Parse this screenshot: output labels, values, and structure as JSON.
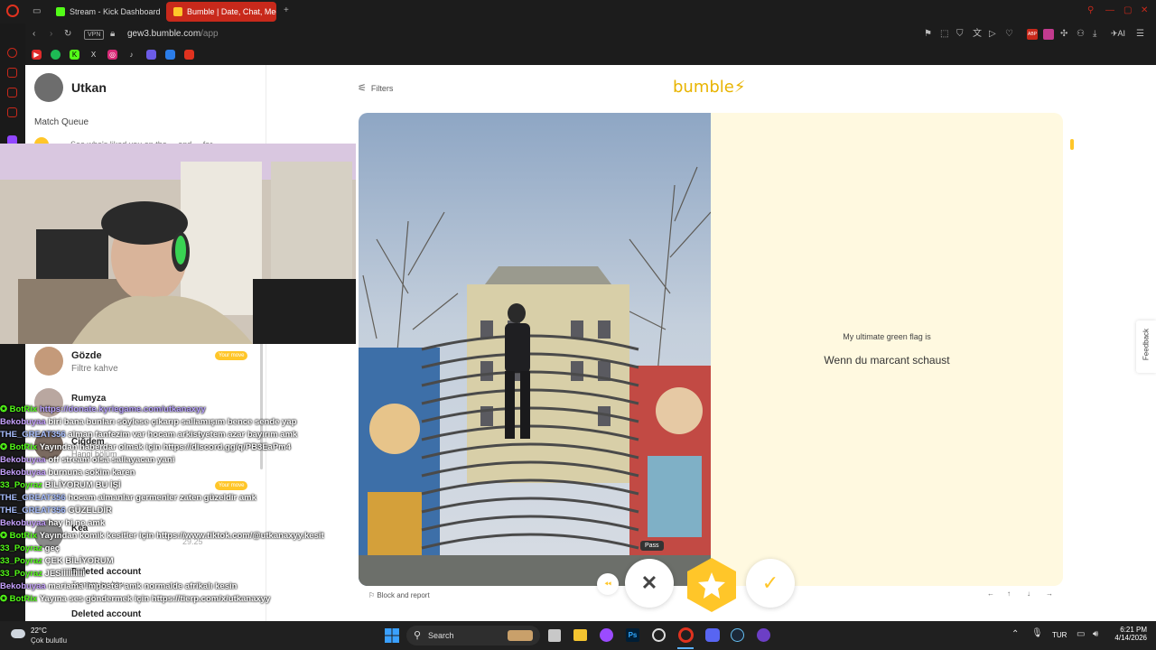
{
  "browser": {
    "tabs": [
      {
        "title": "Stream - Kick Dashboard",
        "color": "#53fc18"
      },
      {
        "title": "Bumble | Date, Chat, Meet",
        "color": "#ffc629"
      }
    ],
    "vpn_label": "VPN",
    "url_host": "gew3.bumble.com",
    "url_path": "/app",
    "ai_label": "AI",
    "abp_label": "ABP"
  },
  "sidebar": {
    "username": "Utkan",
    "match_queue_label": "Match Queue",
    "peek_text": "See who's liked you on the ... and ... for ...",
    "conversations": [
      {
        "name": "Gözde",
        "preview": "Filtre kahve",
        "badge": "Your move"
      },
      {
        "name": "Rumyza",
        "preview": ""
      },
      {
        "name": "Çiğdem",
        "preview": "Hangi bölüm"
      },
      {
        "name": "",
        "preview": "",
        "badge": "Your move"
      },
      {
        "name": "Kea",
        "preview": "",
        "meta": "29.25"
      },
      {
        "name": "Deleted account",
        "preview": "Tamam bu btw"
      },
      {
        "name": "Deleted account",
        "preview": ""
      }
    ]
  },
  "main": {
    "filters_label": "Filters",
    "logo_text": "bumble",
    "prompt_question": "My ultimate green flag is",
    "prompt_answer": "Wenn du marcant schaust",
    "feedback_label": "Feedback",
    "block_report_label": "Block and report",
    "pass_tooltip": "Pass",
    "action_colors": {
      "superswipe": "#ffc629",
      "like": "#ffc629",
      "backtrack": "#ffc629"
    }
  },
  "chat": [
    {
      "user": "BotRix",
      "color": "#53fc18",
      "badge": true,
      "msg": "https://donate.kyriegame.com/utkanaxyy",
      "link": true
    },
    {
      "user": "Bekobuyaa",
      "color": "#b48cff",
      "msg": "biri bana bunları söylese çıkarıp sallamışım bence sende yap"
    },
    {
      "user": "THE_GREAT356",
      "color": "#9fb6ff",
      "msg": "alman fanfezim var hocam arkistyetem azar bayırım amk"
    },
    {
      "user": "BotRix",
      "color": "#53fc18",
      "badge": true,
      "msg": "Yayından haberdar olmak için https://discord.gg/q/PB3EaPm4",
      "link": true
    },
    {
      "user": "Bekobuyaa",
      "color": "#b48cff",
      "msg": "off stream olsa sallayacan yani"
    },
    {
      "user": "Bekobuyaa",
      "color": "#b48cff",
      "msg": "burnuna sokim karen"
    },
    {
      "user": "33_Poyraz",
      "color": "#53fc18",
      "msg": "BİLİYORUM BU İŞİ"
    },
    {
      "user": "THE_GREAT356",
      "color": "#9fb6ff",
      "msg": "hocam almanlar germenler zaten güzeldir amk"
    },
    {
      "user": "THE_GREAT356",
      "color": "#9fb6ff",
      "msg": "GÜZELDİR"
    },
    {
      "user": "Bekobuyaa",
      "color": "#b48cff",
      "msg": "hay hi ne amk"
    },
    {
      "user": "BotRix",
      "color": "#53fc18",
      "badge": true,
      "msg": "Yayından komik kesitler için https://www.tiktok.com/@utkanaxyy.kesit",
      "link": true
    },
    {
      "user": "33_Poyraz",
      "color": "#53fc18",
      "msg": "geç"
    },
    {
      "user": "33_Poyraz",
      "color": "#53fc18",
      "msg": "ÇEK BİLİYORUM"
    },
    {
      "user": "33_Poyraz",
      "color": "#53fc18",
      "msg": "JESİİİİİİİİİİ"
    },
    {
      "user": "Bekobuyaa",
      "color": "#b48cff",
      "msg": "mariama imposter amk normalde afrikalı kesin"
    },
    {
      "user": "BotRix",
      "color": "#53fc18",
      "badge": true,
      "msg": "Yayına ses göndermek için https://tierp.com/x/utkanaxyy",
      "link": true
    }
  ],
  "taskbar": {
    "weather_temp": "22°C",
    "weather_desc": "Çok bulutlu",
    "search_label": "Search",
    "lang": "TUR",
    "time": "6:21 PM",
    "date": "4/14/2026"
  }
}
